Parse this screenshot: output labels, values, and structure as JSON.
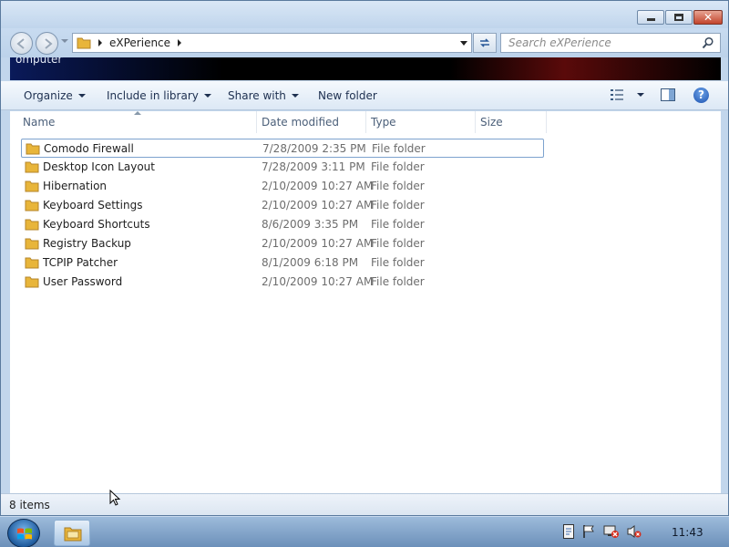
{
  "window": {
    "address": {
      "folder": "eXPerience"
    },
    "search": {
      "placeholder": "Search eXPerience"
    },
    "banner_text": "omputer"
  },
  "toolbar": {
    "organize": "Organize",
    "include_in_library": "Include in library",
    "share_with": "Share with",
    "new_folder": "New folder",
    "help": "?"
  },
  "columns": [
    "Name",
    "Date modified",
    "Type",
    "Size"
  ],
  "files": [
    {
      "name": "Comodo Firewall",
      "date": "7/28/2009 2:35 PM",
      "type": "File folder"
    },
    {
      "name": "Desktop Icon Layout",
      "date": "7/28/2009 3:11 PM",
      "type": "File folder"
    },
    {
      "name": "Hibernation",
      "date": "2/10/2009 10:27 AM",
      "type": "File folder"
    },
    {
      "name": "Keyboard Settings",
      "date": "2/10/2009 10:27 AM",
      "type": "File folder"
    },
    {
      "name": "Keyboard Shortcuts",
      "date": "8/6/2009 3:35 PM",
      "type": "File folder"
    },
    {
      "name": "Registry Backup",
      "date": "2/10/2009 10:27 AM",
      "type": "File folder"
    },
    {
      "name": "TCPIP Patcher",
      "date": "8/1/2009 6:18 PM",
      "type": "File folder"
    },
    {
      "name": "User Password",
      "date": "2/10/2009 10:27 AM",
      "type": "File folder"
    }
  ],
  "status": {
    "item_count": "8 items"
  },
  "taskbar": {
    "clock": "11:43"
  },
  "colors": {
    "folder": "#e8b53a",
    "accent": "#1c52b0",
    "banner_red": "#5a0a0a"
  }
}
